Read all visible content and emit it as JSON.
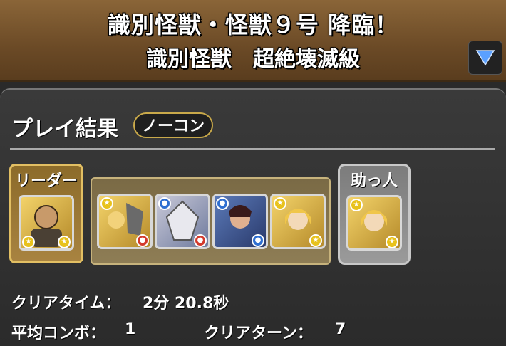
{
  "header": {
    "title_line1": "識別怪獣・怪獣９号 降臨！",
    "title_line2": "識別怪獣　超絶壊滅級"
  },
  "result": {
    "title": "プレイ結果",
    "badge": "ノーコン"
  },
  "team": {
    "leader_label": "リーダー",
    "helper_label": "助っ人",
    "leader": {
      "icon": "bald-character-portrait",
      "attributes": [
        "light",
        "light"
      ]
    },
    "members": [
      {
        "icon": "masked-duo-portrait",
        "attributes": [
          "light",
          "fire"
        ]
      },
      {
        "icon": "armored-knight-portrait",
        "attributes": [
          "water",
          "fire"
        ]
      },
      {
        "icon": "swordsman-portrait",
        "attributes": [
          "water",
          "water"
        ]
      },
      {
        "icon": "blonde-girl-portrait",
        "attributes": [
          "light",
          "light"
        ]
      }
    ],
    "helper": {
      "icon": "blonde-girl-portrait",
      "attributes": [
        "light",
        "light"
      ]
    }
  },
  "stats": {
    "clear_time_label": "クリアタイム：",
    "clear_time_value": "2分 20.8秒",
    "avg_combo_label": "平均コンボ：",
    "avg_combo_value": "1",
    "clear_turn_label": "クリアターン：",
    "clear_turn_value": "7"
  },
  "colors": {
    "header_brown": "#6b4a26",
    "gold_border": "#e2bf63",
    "panel_bg": "#2b2b2b"
  }
}
